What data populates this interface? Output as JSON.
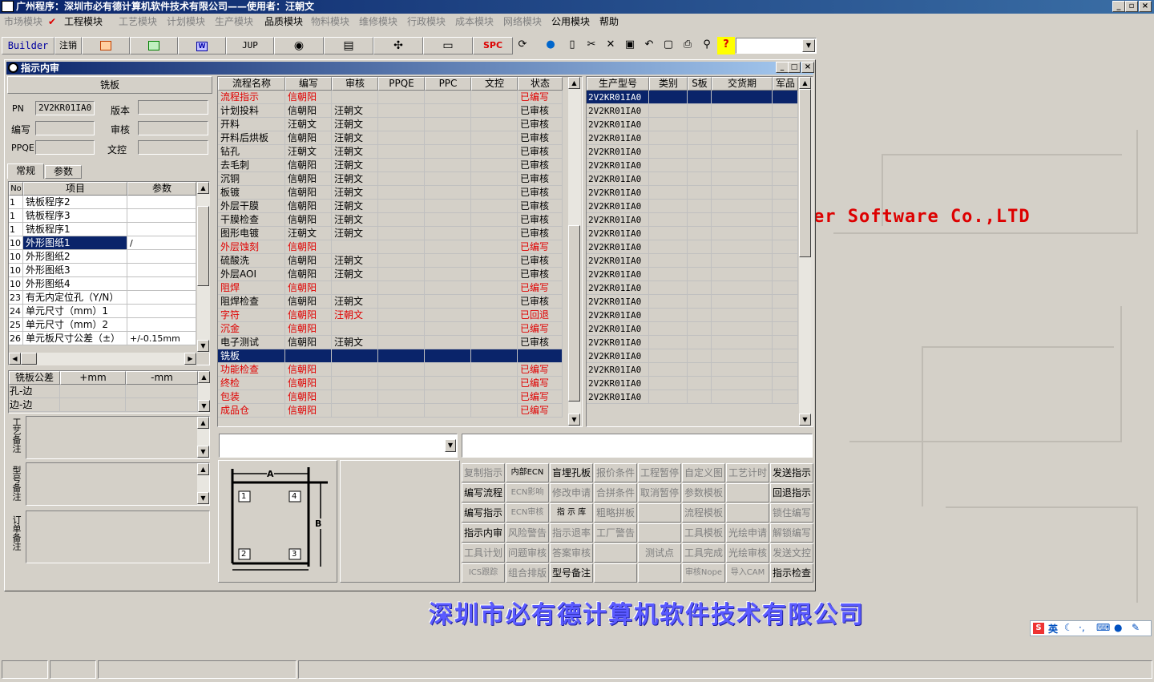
{
  "titlebar": {
    "title": "广州程序：深圳市必有德计算机软件技术有限公司——使用者：汪朝文",
    "minimize": "_",
    "restore": "▫",
    "close": "×"
  },
  "menu": [
    {
      "label": "市场模块",
      "enabled": false
    },
    {
      "label": "工程模块",
      "enabled": true
    },
    {
      "label": "工艺模块",
      "enabled": false
    },
    {
      "label": "计划模块",
      "enabled": false
    },
    {
      "label": "生产模块",
      "enabled": false
    },
    {
      "label": "品质模块",
      "enabled": true
    },
    {
      "label": "物料模块",
      "enabled": false
    },
    {
      "label": "维修模块",
      "enabled": false
    },
    {
      "label": "行政模块",
      "enabled": false
    },
    {
      "label": "成本模块",
      "enabled": false
    },
    {
      "label": "网络模块",
      "enabled": false
    },
    {
      "label": "公用模块",
      "enabled": true
    },
    {
      "label": "帮助",
      "enabled": true
    }
  ],
  "toolbar": {
    "builder": "Builder",
    "logout": "注销",
    "jup": "JUP",
    "spc": "SPC",
    "combo": ""
  },
  "background": {
    "company_en": "er Software Co.,LTD",
    "company_cn": "深圳市必有德计算机软件技术有限公司"
  },
  "window": {
    "title": "指示内审",
    "btn_min": "_",
    "btn_max": "□",
    "btn_close": "×"
  },
  "left": {
    "section_title": "铣板",
    "pn_label": "PN",
    "pn_value": "2V2KR01IA0",
    "version_label": "版本",
    "version_value": "",
    "writer_label": "编写",
    "writer_value": "",
    "reviewer_label": "审核",
    "reviewer_value": "",
    "ppqe_label": "PPQE",
    "ppqe_value": "",
    "doc_label": "文控",
    "doc_value": "",
    "tab_general": "常规",
    "tab_params": "参数",
    "grid_headers": [
      "No",
      "项目",
      "参数"
    ],
    "grid_rows": [
      {
        "no": "1",
        "item": "铣板程序2",
        "param": ""
      },
      {
        "no": "1",
        "item": "铣板程序3",
        "param": ""
      },
      {
        "no": "1",
        "item": "铣板程序1",
        "param": ""
      },
      {
        "no": "10",
        "item": "外形图纸1",
        "param": "/"
      },
      {
        "no": "10",
        "item": "外形图纸2",
        "param": ""
      },
      {
        "no": "10",
        "item": "外形图纸3",
        "param": ""
      },
      {
        "no": "10",
        "item": "外形图纸4",
        "param": ""
      },
      {
        "no": "23",
        "item": "有无内定位孔（Y/N）",
        "param": ""
      },
      {
        "no": "24",
        "item": "单元尺寸（mm）1",
        "param": ""
      },
      {
        "no": "25",
        "item": "单元尺寸（mm）2",
        "param": ""
      },
      {
        "no": "26",
        "item": "单元板尺寸公差（±）",
        "param": "+/-0.15mm"
      }
    ],
    "tol_headers": [
      "铣板公差",
      "+mm",
      "-mm"
    ],
    "tol_rows": [
      "孔-边",
      "边-边"
    ],
    "note1": "工艺备注",
    "note2": "型号备注",
    "note3": "订单备注"
  },
  "flow": {
    "headers": [
      "流程名称",
      "编写",
      "审核",
      "PPQE",
      "PPC",
      "文控",
      "状态"
    ],
    "rows": [
      {
        "name": "流程指示",
        "writer": "信朝阳",
        "reviewer": "",
        "status": "已编写",
        "red": true
      },
      {
        "name": "计划投料",
        "writer": "信朝阳",
        "reviewer": "汪朝文",
        "status": "已审核",
        "red": false
      },
      {
        "name": "开料",
        "writer": "汪朝文",
        "reviewer": "汪朝文",
        "status": "已审核",
        "red": false
      },
      {
        "name": "开料后烘板",
        "writer": "信朝阳",
        "reviewer": "汪朝文",
        "status": "已审核",
        "red": false
      },
      {
        "name": "钻孔",
        "writer": "汪朝文",
        "reviewer": "汪朝文",
        "status": "已审核",
        "red": false
      },
      {
        "name": "去毛刺",
        "writer": "信朝阳",
        "reviewer": "汪朝文",
        "status": "已审核",
        "red": false
      },
      {
        "name": "沉铜",
        "writer": "信朝阳",
        "reviewer": "汪朝文",
        "status": "已审核",
        "red": false
      },
      {
        "name": "板镀",
        "writer": "信朝阳",
        "reviewer": "汪朝文",
        "status": "已审核",
        "red": false
      },
      {
        "name": "外层干膜",
        "writer": "信朝阳",
        "reviewer": "汪朝文",
        "status": "已审核",
        "red": false
      },
      {
        "name": "干膜检查",
        "writer": "信朝阳",
        "reviewer": "汪朝文",
        "status": "已审核",
        "red": false
      },
      {
        "name": "图形电镀",
        "writer": "汪朝文",
        "reviewer": "汪朝文",
        "status": "已审核",
        "red": false
      },
      {
        "name": "外层蚀刻",
        "writer": "信朝阳",
        "reviewer": "",
        "status": "已编写",
        "red": true
      },
      {
        "name": "硫酸洗",
        "writer": "信朝阳",
        "reviewer": "汪朝文",
        "status": "已审核",
        "red": false
      },
      {
        "name": "外层AOI",
        "writer": "信朝阳",
        "reviewer": "汪朝文",
        "status": "已审核",
        "red": false
      },
      {
        "name": "阻焊",
        "writer": "信朝阳",
        "reviewer": "",
        "status": "已编写",
        "red": true
      },
      {
        "name": "阻焊检查",
        "writer": "信朝阳",
        "reviewer": "汪朝文",
        "status": "已审核",
        "red": false
      },
      {
        "name": "字符",
        "writer": "信朝阳",
        "reviewer": "汪朝文",
        "status": "已回退",
        "red": true
      },
      {
        "name": "沉金",
        "writer": "信朝阳",
        "reviewer": "",
        "status": "已编写",
        "red": true
      },
      {
        "name": "电子测试",
        "writer": "信朝阳",
        "reviewer": "汪朝文",
        "status": "已审核",
        "red": false
      },
      {
        "name": "铣板",
        "writer": "",
        "reviewer": "",
        "status": "",
        "red": true,
        "selected": true
      },
      {
        "name": "功能检查",
        "writer": "信朝阳",
        "reviewer": "",
        "status": "已编写",
        "red": true
      },
      {
        "name": "终检",
        "writer": "信朝阳",
        "reviewer": "",
        "status": "已编写",
        "red": true
      },
      {
        "name": "包装",
        "writer": "信朝阳",
        "reviewer": "",
        "status": "已编写",
        "red": true
      },
      {
        "name": "成品仓",
        "writer": "信朝阳",
        "reviewer": "",
        "status": "已编写",
        "red": true
      }
    ]
  },
  "models": {
    "headers": [
      "生产型号",
      "类别",
      "S板",
      "交货期",
      "军品"
    ],
    "rows": [
      "2V2KR01IA0",
      "2V2KR01IA0",
      "2V2KR01IA0",
      "2V2KR01IA0",
      "2V2KR01IA0",
      "2V2KR01IA0",
      "2V2KR01IA0",
      "2V2KR01IA0",
      "2V2KR01IA0",
      "2V2KR01IA0",
      "2V2KR01IA0",
      "2V2KR01IA0",
      "2V2KR01IA0",
      "2V2KR01IA0",
      "2V2KR01IA0",
      "2V2KR01IA0",
      "2V2KR01IA0",
      "2V2KR01IA0",
      "2V2KR01IA0",
      "2V2KR01IA0",
      "2V2KR01IA0",
      "2V2KR01IA0",
      "2V2KR01IA0"
    ]
  },
  "diagram": {
    "a": "A",
    "b": "B",
    "n1": "1",
    "n2": "2",
    "n3": "3",
    "n4": "4"
  },
  "buttons": [
    [
      {
        "l": "复制指示",
        "on": false
      },
      {
        "l": "内部ECN",
        "on": true
      },
      {
        "l": "盲埋孔板",
        "on": true
      },
      {
        "l": "报价条件",
        "on": false
      },
      {
        "l": "工程暂停",
        "on": false
      },
      {
        "l": "自定义图",
        "on": false
      },
      {
        "l": "工艺计时",
        "on": false
      },
      {
        "l": "发送指示",
        "on": true
      }
    ],
    [
      {
        "l": "编写流程",
        "on": true
      },
      {
        "l": "ECN影响",
        "on": false
      },
      {
        "l": "修改申请",
        "on": false
      },
      {
        "l": "合拼条件",
        "on": false
      },
      {
        "l": "取消暂停",
        "on": false
      },
      {
        "l": "参数模板",
        "on": false
      },
      {
        "l": "",
        "on": false
      },
      {
        "l": "回退指示",
        "on": true
      }
    ],
    [
      {
        "l": "编写指示",
        "on": true
      },
      {
        "l": "ECN审核",
        "on": false
      },
      {
        "l": "指 示 库",
        "on": true
      },
      {
        "l": "粗略拼板",
        "on": false
      },
      {
        "l": "",
        "on": false
      },
      {
        "l": "流程模板",
        "on": false
      },
      {
        "l": "",
        "on": false
      },
      {
        "l": "锁住编写",
        "on": false
      }
    ],
    [
      {
        "l": "指示内审",
        "on": true
      },
      {
        "l": "风险警告",
        "on": false
      },
      {
        "l": "指示退率",
        "on": false
      },
      {
        "l": "工厂警告",
        "on": false
      },
      {
        "l": "",
        "on": false
      },
      {
        "l": "工具模板",
        "on": false
      },
      {
        "l": "光绘申请",
        "on": false
      },
      {
        "l": "解锁编写",
        "on": false
      }
    ],
    [
      {
        "l": "工具计划",
        "on": false
      },
      {
        "l": "问题审核",
        "on": false
      },
      {
        "l": "答案审核",
        "on": false
      },
      {
        "l": "",
        "on": false
      },
      {
        "l": "测试点",
        "on": false
      },
      {
        "l": "工具完成",
        "on": false
      },
      {
        "l": "光绘审核",
        "on": false
      },
      {
        "l": "发送文控",
        "on": false
      }
    ],
    [
      {
        "l": "ICS跟踪",
        "on": false
      },
      {
        "l": "组合排版",
        "on": false
      },
      {
        "l": "型号备注",
        "on": true
      },
      {
        "l": "",
        "on": false
      },
      {
        "l": "",
        "on": false
      },
      {
        "l": "审核Nope",
        "on": false
      },
      {
        "l": "导入CAM",
        "on": false
      },
      {
        "l": "指示检查",
        "on": true
      }
    ]
  ],
  "ime": {
    "lang": "英"
  },
  "colors": {
    "title_blue": "#0a246a",
    "select_blue": "#0a246a",
    "status_red": "#e00000",
    "company_blue": "#5a5aff"
  }
}
